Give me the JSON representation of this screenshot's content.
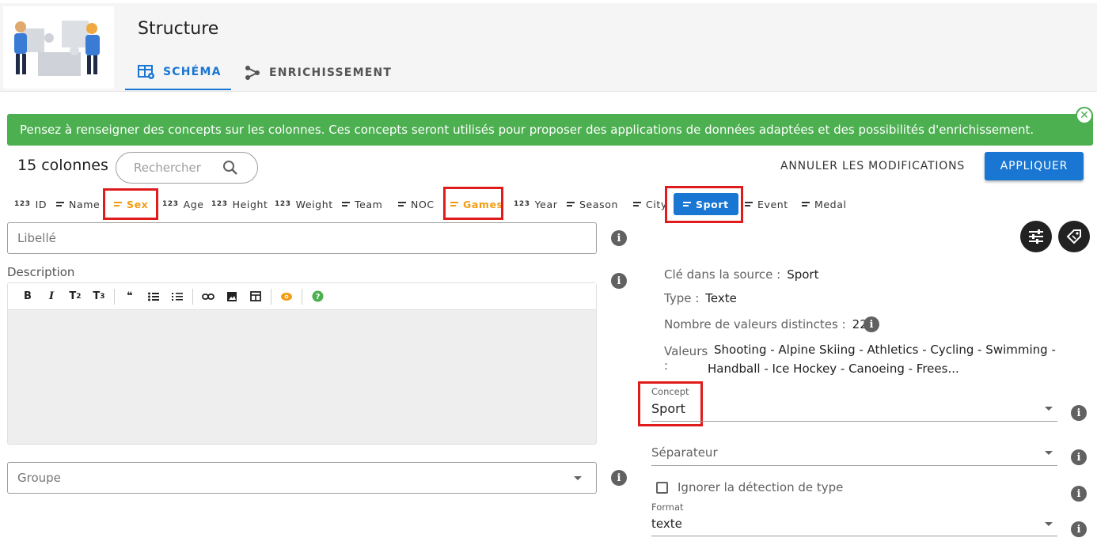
{
  "header": {
    "title": "Structure",
    "tabs": [
      {
        "label": "Schéma",
        "icon": "table-settings-icon",
        "active": true
      },
      {
        "label": "Enrichissement",
        "icon": "graph-nodes-icon",
        "active": false
      }
    ]
  },
  "alert": {
    "message": "Pensez à renseigner des concepts sur les colonnes. Ces concepts seront utilisés pour proposer des applications de données adaptées et des possibilités d'enrichissement.",
    "color": "#4caf50"
  },
  "toolbar": {
    "column_count": "15 colonnes",
    "search_placeholder": "Rechercher",
    "cancel_label": "Annuler les modifications",
    "apply_label": "Appliquer"
  },
  "columns": [
    {
      "name": "ID",
      "type_icon": "123"
    },
    {
      "name": "Name",
      "type_icon": "text-lines"
    },
    {
      "name": "Sex",
      "type_icon": "text-lines",
      "highlight": "orange"
    },
    {
      "name": "Age",
      "type_icon": "123"
    },
    {
      "name": "Height",
      "type_icon": "123"
    },
    {
      "name": "Weight",
      "type_icon": "123"
    },
    {
      "name": "Team",
      "type_icon": "text-lines"
    },
    {
      "name": "NOC",
      "type_icon": "text-lines"
    },
    {
      "name": "Games",
      "type_icon": "text-lines",
      "highlight": "orange"
    },
    {
      "name": "Year",
      "type_icon": "123"
    },
    {
      "name": "Season",
      "type_icon": "text-lines"
    },
    {
      "name": "City",
      "type_icon": "text-lines"
    },
    {
      "name": "Sport",
      "type_icon": "text-lines",
      "selected": true
    },
    {
      "name": "Event",
      "type_icon": "text-lines"
    },
    {
      "name": "Medal",
      "type_icon": "text-lines"
    }
  ],
  "form": {
    "libelle_placeholder": "Libellé",
    "description_label": "Description",
    "groupe_placeholder": "Groupe"
  },
  "editor_toolbar": [
    "B",
    "I",
    "T2",
    "T3",
    "quote",
    "bullet-list",
    "numbered-list",
    "link",
    "image",
    "table",
    "preview",
    "help"
  ],
  "details": {
    "source_key_label": "Clé dans la source :",
    "source_key_value": "Sport",
    "type_label": "Type :",
    "type_value": "Texte",
    "distinct_label": "Nombre de valeurs distinctes :",
    "distinct_value": "22",
    "values_label": "Valeurs :",
    "values_value": "Shooting - Alpine Skiing - Athletics - Cycling - Swimming - Handball - Ice Hockey - Canoeing - Frees...",
    "concept_label": "Concept",
    "concept_value": "Sport",
    "separator_placeholder": "Séparateur",
    "ignore_type_label": "Ignorer la détection de type",
    "format_label": "Format",
    "format_value": "texte"
  },
  "colors": {
    "accent": "#1976d2",
    "highlight": "#f39c12",
    "annotation": "#e01b1b"
  }
}
